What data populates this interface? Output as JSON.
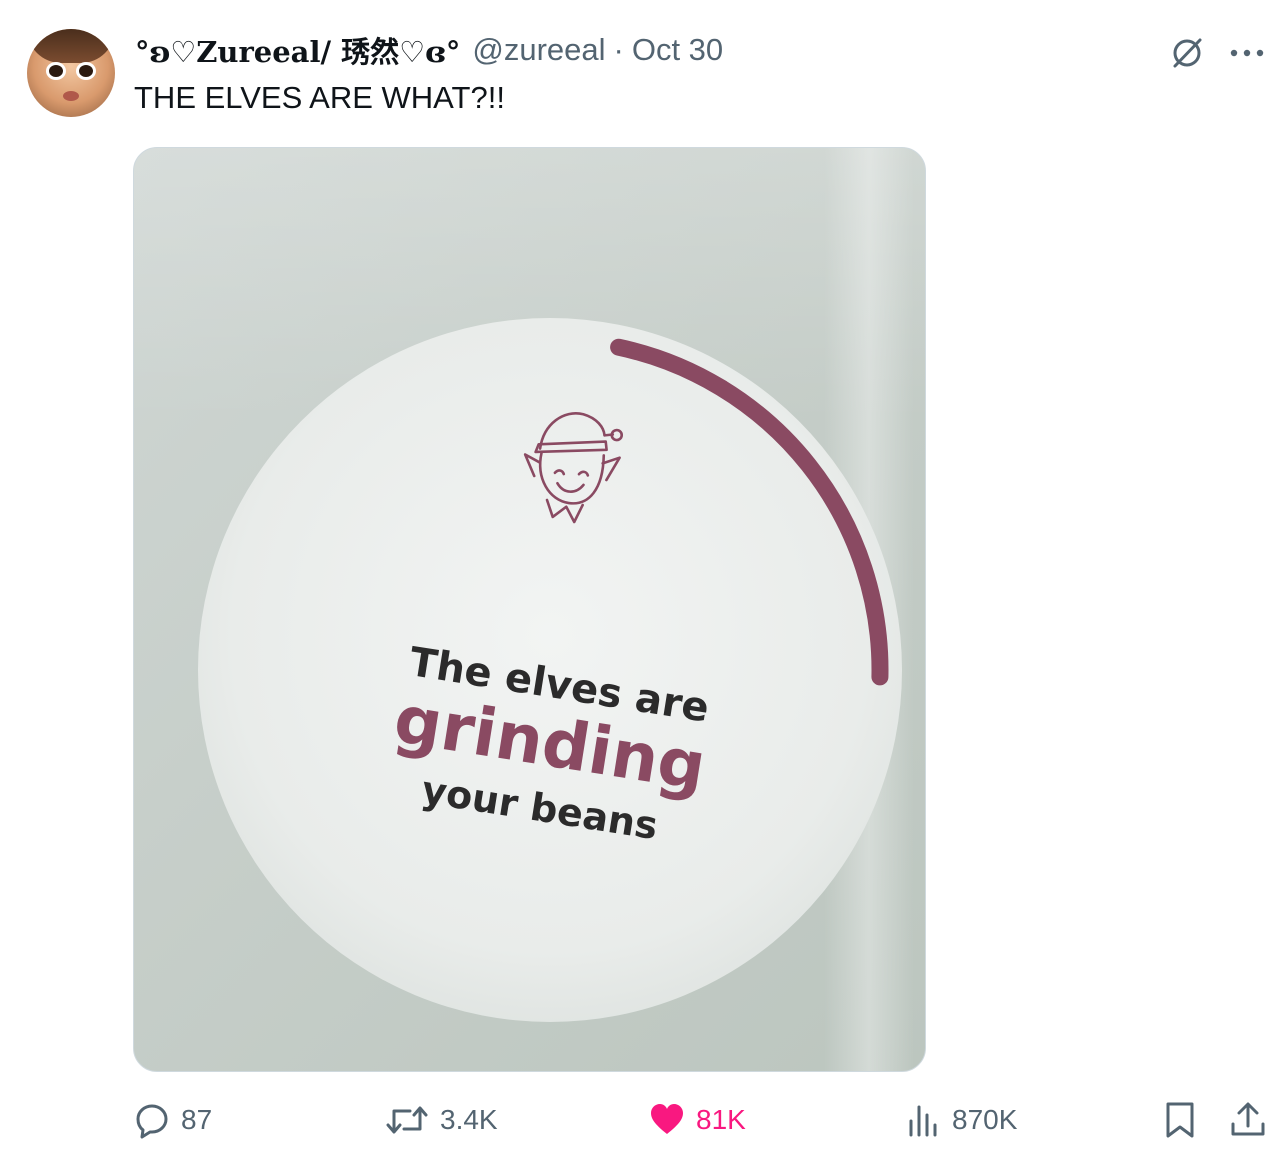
{
  "author": {
    "display_name": "°ʚ♡Zureeal/ 琇然♡ɞ°",
    "handle": "@zureeal",
    "separator": "·",
    "date": "Oct 30"
  },
  "tweet": {
    "text": "THE ELVES ARE WHAT?!!"
  },
  "media": {
    "line1": "The elves are",
    "line2": "grinding",
    "line3": "your beans",
    "icon": "elf-icon",
    "progress_fraction": 0.22,
    "accent_color": "#8a4a62"
  },
  "actions": {
    "replies": "87",
    "reposts": "3.4K",
    "likes": "81K",
    "views": "870K",
    "like_color": "#f91880"
  },
  "icons": {
    "grok": "grok-icon",
    "more": "more-icon",
    "reply": "reply-icon",
    "repost": "repost-icon",
    "like": "heart-icon",
    "views": "views-icon",
    "bookmark": "bookmark-icon",
    "share": "share-icon"
  }
}
